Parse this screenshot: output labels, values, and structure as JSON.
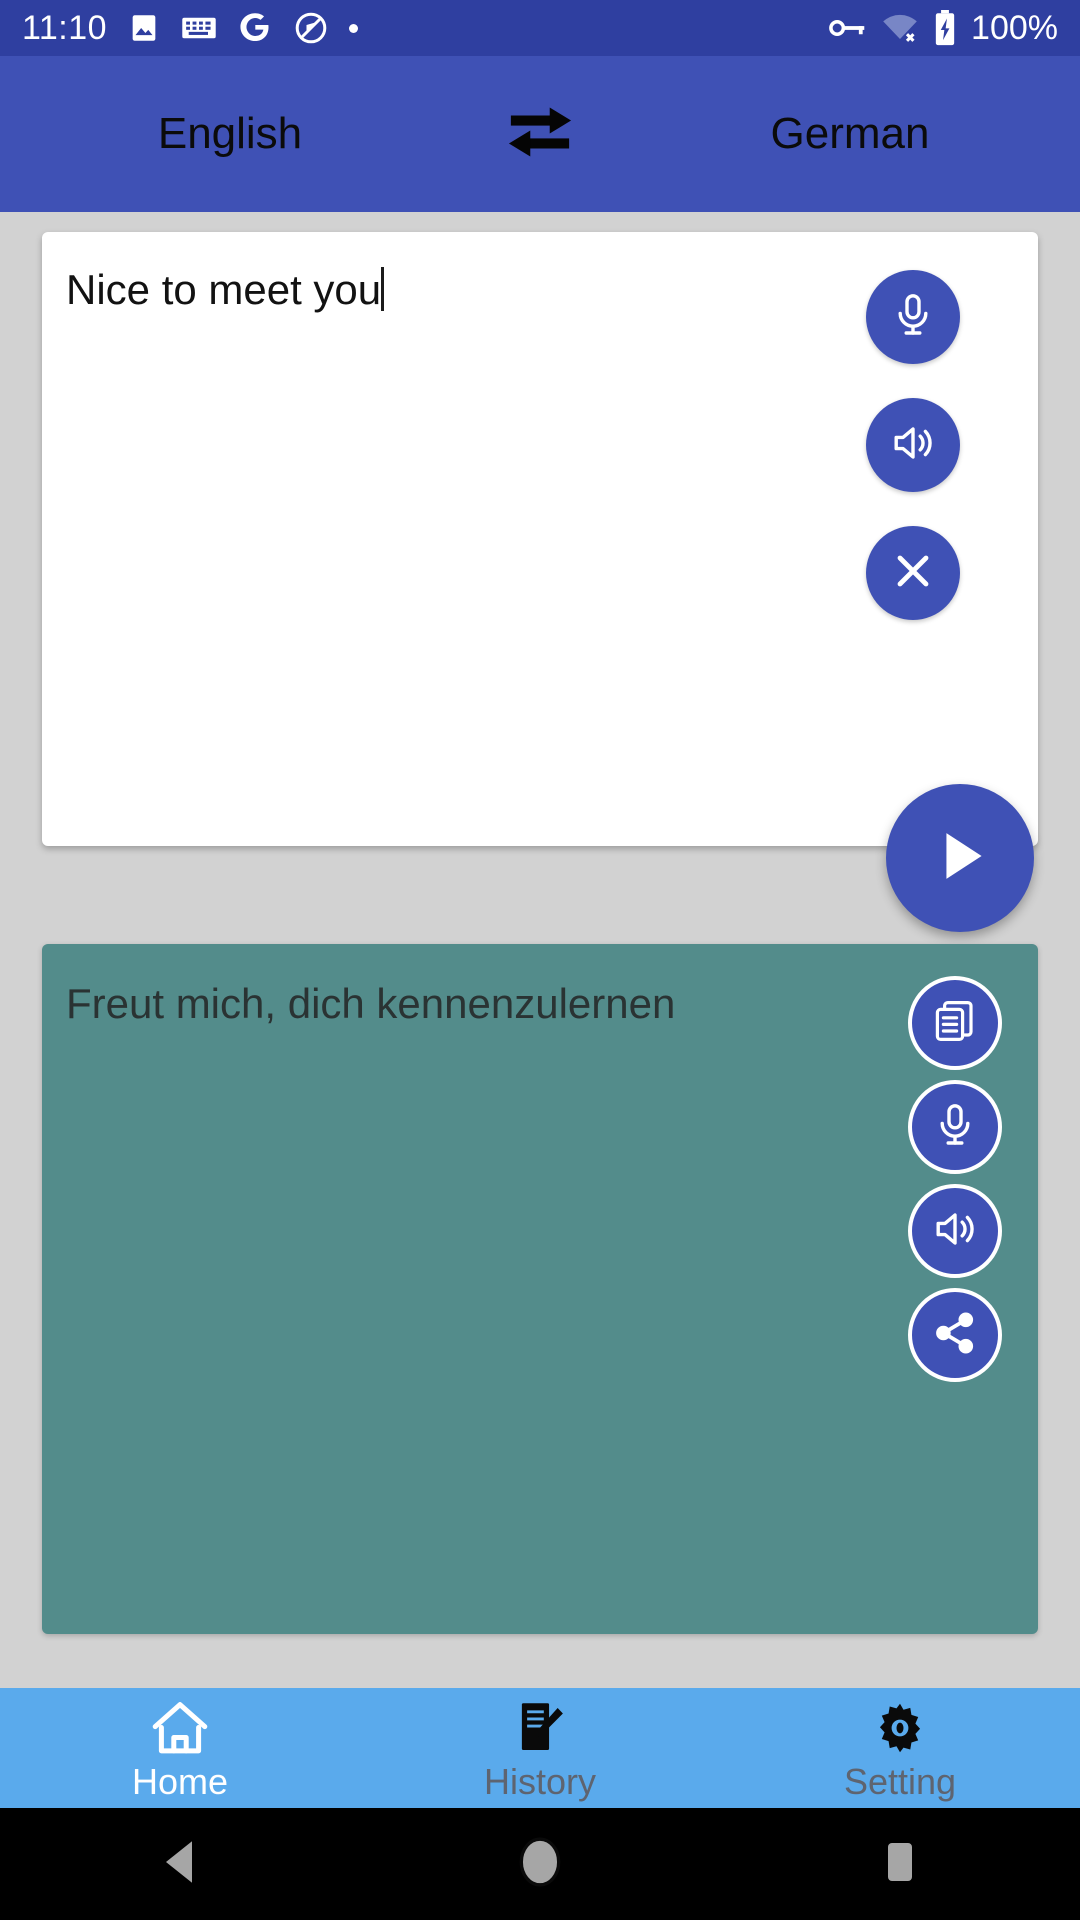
{
  "status_bar": {
    "clock": "11:10",
    "battery_percent": "100%",
    "icons": [
      "photo-icon",
      "keyboard-icon",
      "google-g-icon",
      "quick-icon",
      "dot-icon"
    ],
    "right_icons": [
      "vpn-key-icon",
      "wifi-off-icon",
      "battery-charging-icon"
    ],
    "background": "#2f3fa0"
  },
  "language_bar": {
    "source_language": "English",
    "target_language": "German",
    "swap_icon": "swap-horizontal-icon",
    "background": "#3f51b5"
  },
  "input_card": {
    "text": "Nice to meet you",
    "has_caret": true,
    "background": "#ffffff",
    "buttons": [
      {
        "name": "mic",
        "icon": "microphone-icon",
        "label": "Speak input"
      },
      {
        "name": "speak",
        "icon": "speaker-icon",
        "label": "Play input"
      },
      {
        "name": "clear",
        "icon": "close-icon",
        "label": "Clear input"
      }
    ],
    "translate_button": {
      "icon": "play-icon",
      "label": "Translate"
    }
  },
  "output_card": {
    "text": "Freut mich, dich kennenzulernen",
    "background": "#538c8b",
    "buttons": [
      {
        "name": "copy",
        "icon": "copy-icon",
        "label": "Copy translation"
      },
      {
        "name": "mic",
        "icon": "microphone-icon",
        "label": "Speak output"
      },
      {
        "name": "speak",
        "icon": "speaker-icon",
        "label": "Play translation"
      },
      {
        "name": "share",
        "icon": "share-icon",
        "label": "Share translation"
      }
    ]
  },
  "tab_bar": {
    "background": "#5aaaec",
    "tabs": [
      {
        "label": "Home",
        "icon": "home-icon",
        "active": true
      },
      {
        "label": "History",
        "icon": "note-edit-icon",
        "active": false
      },
      {
        "label": "Setting",
        "icon": "gear-icon",
        "active": false
      }
    ]
  },
  "system_nav": {
    "background": "#000000",
    "keys": [
      "back-icon",
      "home-circle-icon",
      "recents-square-icon"
    ]
  },
  "colors": {
    "primary": "#3f51b5",
    "status_bar": "#2f3fa0",
    "page_background": "#d2d2d2",
    "output_card": "#538c8b",
    "tab_bar": "#5aaaec"
  }
}
